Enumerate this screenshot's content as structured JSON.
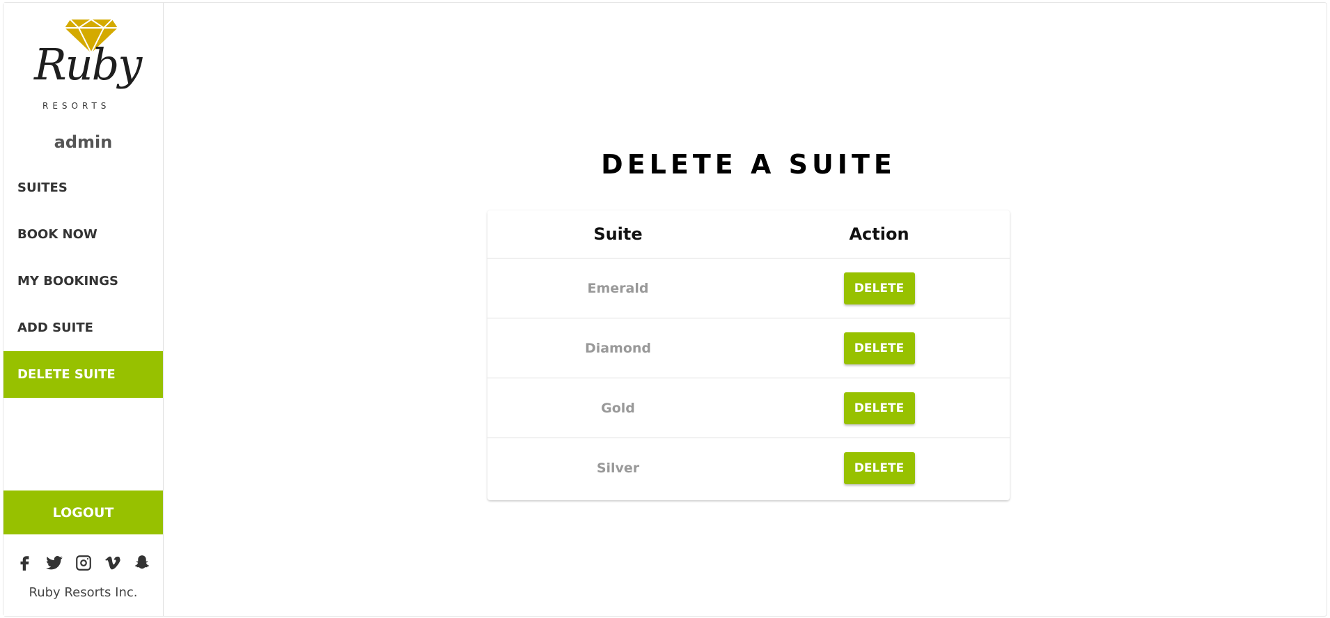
{
  "brand": {
    "logo_script": "Ruby",
    "logo_sub": "RESORTS",
    "gem_color": "#d4aa00"
  },
  "user": {
    "name": "admin"
  },
  "nav": {
    "items": [
      {
        "label": "SUITES",
        "active": false
      },
      {
        "label": "BOOK NOW",
        "active": false
      },
      {
        "label": "MY BOOKINGS",
        "active": false
      },
      {
        "label": "ADD SUITE",
        "active": false
      },
      {
        "label": "DELETE SUITE",
        "active": true
      }
    ],
    "logout_label": "LOGOUT"
  },
  "socials": [
    "facebook-icon",
    "twitter-icon",
    "instagram-icon",
    "vimeo-icon",
    "snapchat-icon"
  ],
  "footer": {
    "company": "Ruby Resorts Inc."
  },
  "main": {
    "title": "DELETE A SUITE",
    "table": {
      "headers": {
        "suite": "Suite",
        "action": "Action"
      },
      "rows": [
        {
          "suite": "Emerald",
          "action": "DELETE"
        },
        {
          "suite": "Diamond",
          "action": "DELETE"
        },
        {
          "suite": "Gold",
          "action": "DELETE"
        },
        {
          "suite": "Silver",
          "action": "DELETE"
        }
      ]
    }
  },
  "colors": {
    "accent": "#97c100",
    "text_dark": "#333333",
    "text_muted": "#999999"
  }
}
